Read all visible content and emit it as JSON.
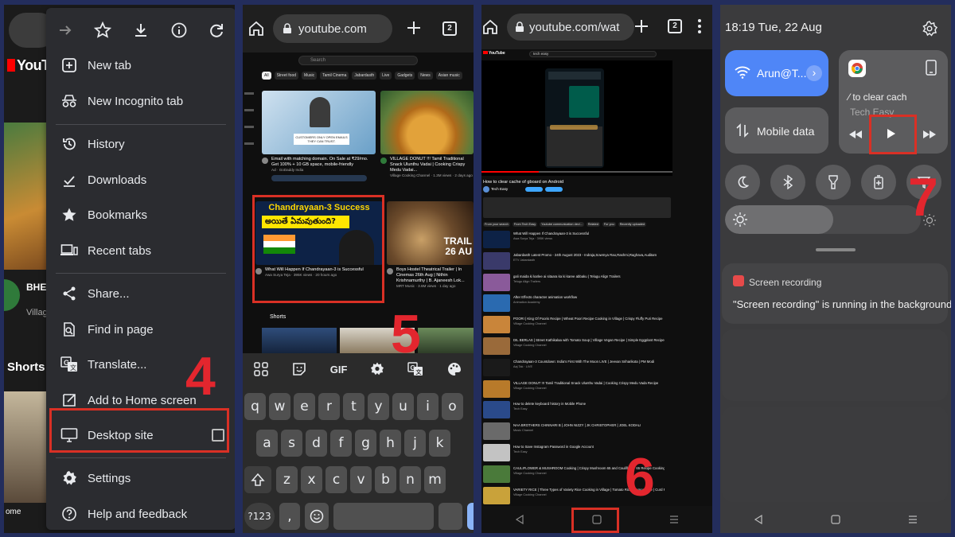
{
  "panel1": {
    "step_number": "4",
    "yt_logo_text": "YouTube",
    "bg_video_title": "BHEL Two (",
    "bg_video_meta": "Village ago",
    "shorts_label": "Shorts",
    "home_label": "ome",
    "menu_items": [
      {
        "label": "New tab",
        "icon": "new-tab-icon"
      },
      {
        "label": "New Incognito tab",
        "icon": "incognito-icon"
      },
      {
        "label": "History",
        "icon": "history-icon"
      },
      {
        "label": "Downloads",
        "icon": "downloads-icon"
      },
      {
        "label": "Bookmarks",
        "icon": "bookmarks-icon"
      },
      {
        "label": "Recent tabs",
        "icon": "recent-tabs-icon"
      },
      {
        "label": "Share...",
        "icon": "share-icon"
      },
      {
        "label": "Find in page",
        "icon": "find-icon"
      },
      {
        "label": "Translate...",
        "icon": "translate-icon"
      },
      {
        "label": "Add to Home screen",
        "icon": "add-home-icon"
      },
      {
        "label": "Desktop site",
        "icon": "desktop-icon"
      },
      {
        "label": "Settings",
        "icon": "settings-icon"
      },
      {
        "label": "Help and feedback",
        "icon": "help-icon"
      }
    ]
  },
  "panel2": {
    "step_number": "5",
    "url": "youtube.com",
    "tab_count": "2",
    "search_placeholder": "Search",
    "chips": [
      "All",
      "Street food",
      "Music",
      "Tamil Cinema",
      "Jabardasth",
      "Live",
      "Gadgets",
      "News",
      "Asian music"
    ],
    "card1": {
      "title": "Email with matching domain. On Sale at ₹29/mo. Get 100% + 10 GB space, mobile-friendly",
      "meta": "Ad · GoDaddy India",
      "banner": "CUSTOMERS ONLY OPEN EMAILS THEY CAN TRUST."
    },
    "card2": {
      "title": "VILLAGE DONUT !!! Tamil Traditional Snack Ulunthu Vadai | Cooking Crispy Medu Vadai...",
      "meta": "Village Cooking Channel · 1.3M views · 2 days ago"
    },
    "card3": {
      "title": "What Will Happen If Chandrayaan-3 is Successful",
      "meta": "Awa Surya Teja · 395K views · 20 hours ago",
      "banner": "Chandrayaan-3 Success",
      "telugu": "అయితే ఏమవుతుంది?"
    },
    "card4": {
      "title": "Boys Hostel Theatrical Trailer | In Cinemas 26th Aug | Nithin Krishnamurthy | B. Ajaneesh Lok...",
      "meta": "MRT Music · 3.6M views · 1 day ago",
      "overlay": "TRAIL 26 AU"
    },
    "shorts_label": "Shorts",
    "keyboard": {
      "toolbar": [
        "GIF"
      ],
      "row1": [
        "q",
        "w",
        "e",
        "r",
        "t",
        "y",
        "u",
        "i",
        "o"
      ],
      "row2": [
        "a",
        "s",
        "d",
        "f",
        "g",
        "h",
        "j",
        "k"
      ],
      "row3": [
        "z",
        "x",
        "c",
        "v",
        "b",
        "n",
        "m"
      ],
      "sym_key": "?123",
      "comma": ","
    }
  },
  "panel3": {
    "step_number": "6",
    "url": "youtube.com/wat",
    "tab_count": "2",
    "search_text": "tech easy",
    "video_title": "How to clear cache of gboard on Android",
    "channel": "Tech Easy",
    "chips": [
      "From your search",
      "From Tech Easy",
      "Youtube communication devi...",
      "Related",
      "For you",
      "Recently uploaded"
    ],
    "related": [
      {
        "title": "What Will Happen If Chandrayaan-3 is Successful",
        "meta": "Awa Surya Teja · 395K views"
      },
      {
        "title": "Jabardasth Latest Promo - 24th August 2023 - Indraja,Sowmya Rao,Rashmi,Raghava,Auditam",
        "meta": "ETV Jabardasth"
      },
      {
        "title": "gali maida ki karlee ai sitaara ka ki karee abbaku | Telugu Align Trailers",
        "meta": "Telugu Align Trailers"
      },
      {
        "title": "After Effects character animation workflow",
        "meta": "Animation Academy"
      },
      {
        "title": "POORI | King Of Pooris Recipe | Wheat Poori Recipe Cooking in Village | Crispy Fluffy Puri Recipe",
        "meta": "Village Cooking Channel"
      },
      {
        "title": "DIL BERLAS | Street Kathikalaa with Tomato Soup | Village Vegan Recipe | Simple Eggplant Recipe",
        "meta": "Village Cooking Channel"
      },
      {
        "title": "Chandrayaan-3 Countdown: India's First With The Moon LIVE | Jeevan Sriharikota | PM Modi",
        "meta": "Aaj Tak · LIVE"
      },
      {
        "title": "VILLAGE DONUT !!! Tamil Traditional Snack Ulunthu Vadai | Cooking Crispy Medu Vada Recipe",
        "meta": "Village Cooking Channel"
      },
      {
        "title": "How to delete keyboard history in Mobile Phone",
        "meta": "Tech Easy"
      },
      {
        "title": "NAA BROTHERS CHINNARI B | JOHN NIZZY | JK CHRISTOPHER | JOEL KODALI",
        "meta": "Music Channel"
      },
      {
        "title": "How to Save Instagram Password in Google Account",
        "meta": "Tech Easy"
      },
      {
        "title": "CAULIFLOWER & MUSHROOM Cooking | Crispy Mushroom 65 and Cauliflower 65 Recipe Cooking in Village",
        "meta": "Village Cooking Channel"
      },
      {
        "title": "VARIETY RICE | Three Types of Variety Rice Cooking in Village | Tomato Rice | Lemon Rice | Curd Rice",
        "meta": "Village Cooking Channel"
      }
    ]
  },
  "panel4": {
    "step_number": "7",
    "time": "18:19",
    "date": "Tue, 22 Aug",
    "wifi_label": "Arun@T...",
    "mobile_data_label": "Mobile data",
    "media_title": "to clear cach",
    "media_artist": "Tech Easy",
    "notif_app": "Screen recording",
    "notif_text": "\"Screen recording\" is running in the background"
  }
}
